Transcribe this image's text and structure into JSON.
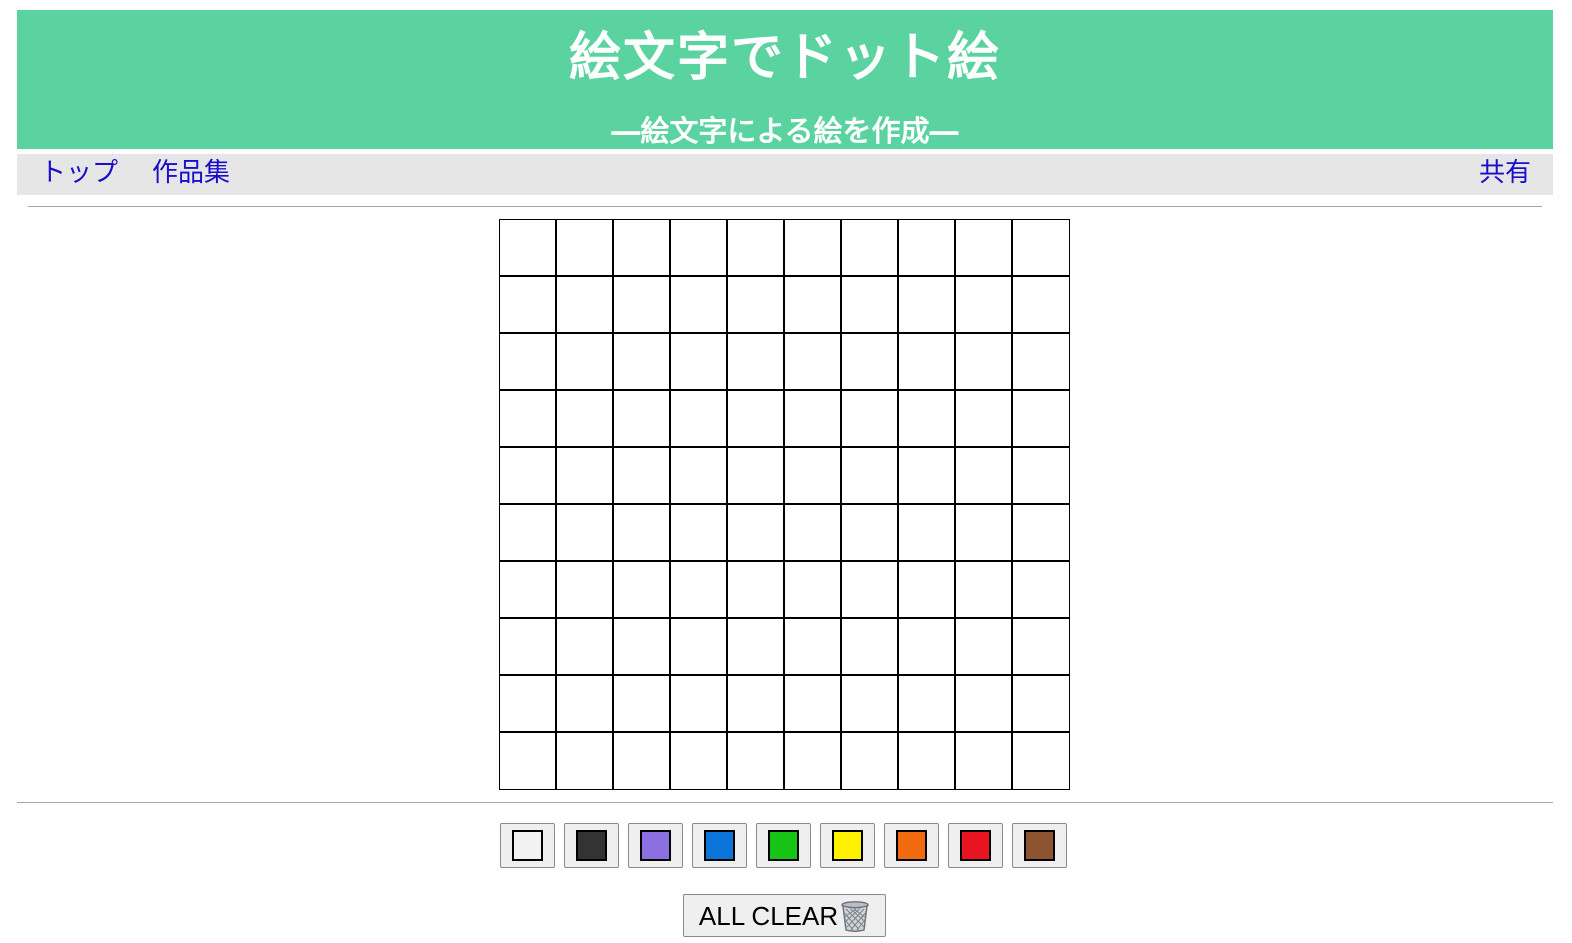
{
  "header": {
    "title": "絵文字でドット絵",
    "subtitle": "―絵文字による絵を作成―",
    "background_color": "#5ad3a0"
  },
  "nav": {
    "top_label": "トップ",
    "works_label": "作品集",
    "share_label": "共有",
    "link_color": "#1a0dcc"
  },
  "canvas": {
    "rows": 10,
    "columns": 10,
    "cell_color": "#ffffff"
  },
  "palette": {
    "colors": [
      {
        "name": "white",
        "hex": "#f2f2f2"
      },
      {
        "name": "black",
        "hex": "#333333"
      },
      {
        "name": "purple",
        "hex": "#8c6fe0"
      },
      {
        "name": "blue",
        "hex": "#0a74d9"
      },
      {
        "name": "green",
        "hex": "#16c416"
      },
      {
        "name": "yellow",
        "hex": "#fff200"
      },
      {
        "name": "orange",
        "hex": "#f26a0f"
      },
      {
        "name": "red",
        "hex": "#e8141f"
      },
      {
        "name": "brown",
        "hex": "#8c5430"
      }
    ]
  },
  "actions": {
    "clear_label": "ALL CLEAR",
    "clear_icon": "trash-can-icon"
  }
}
